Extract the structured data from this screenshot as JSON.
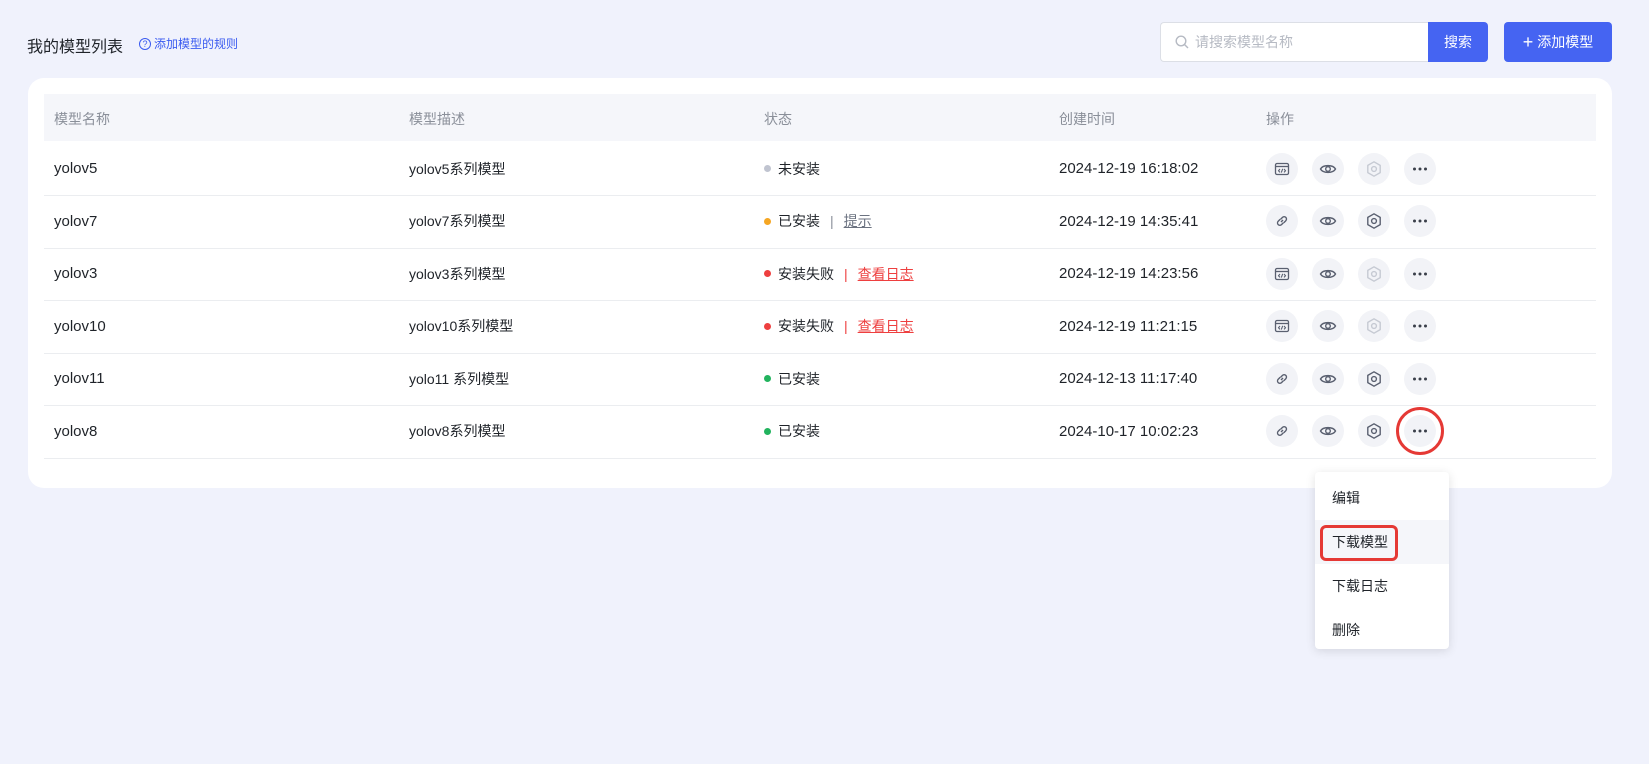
{
  "header": {
    "title": "我的模型列表",
    "rule_link": "添加模型的规则",
    "search_placeholder": "请搜索模型名称",
    "search_button": "搜索",
    "add_button": "添加模型"
  },
  "table": {
    "columns": [
      "模型名称",
      "模型描述",
      "状态",
      "创建时间",
      "操作"
    ],
    "rows": [
      {
        "name": "yolov5",
        "desc": "yolov5系列模型",
        "status": "未安装",
        "status_color": "#c0c4d0",
        "action_text": "",
        "action_style": "",
        "time": "2024-12-19 16:18:02",
        "first_icon": "code-window-icon",
        "settings_enabled": false
      },
      {
        "name": "yolov7",
        "desc": "yolov7系列模型",
        "status": "已安装",
        "status_color": "#f5a623",
        "action_text": "提示",
        "action_style": "gray",
        "time": "2024-12-19 14:35:41",
        "first_icon": "link-icon",
        "settings_enabled": true
      },
      {
        "name": "yolov3",
        "desc": "yolov3系列模型",
        "status": "安装失败",
        "status_color": "#ee3f3f",
        "action_text": "查看日志",
        "action_style": "red",
        "time": "2024-12-19 14:23:56",
        "first_icon": "code-window-icon",
        "settings_enabled": false
      },
      {
        "name": "yolov10",
        "desc": "yolov10系列模型",
        "status": "安装失败",
        "status_color": "#ee3f3f",
        "action_text": "查看日志",
        "action_style": "red",
        "time": "2024-12-19 11:21:15",
        "first_icon": "code-window-icon",
        "settings_enabled": false
      },
      {
        "name": "yolov11",
        "desc": "yolo11 系列模型",
        "status": "已安装",
        "status_color": "#22b35e",
        "action_text": "",
        "action_style": "",
        "time": "2024-12-13 11:17:40",
        "first_icon": "link-icon",
        "settings_enabled": true
      },
      {
        "name": "yolov8",
        "desc": "yolov8系列模型",
        "status": "已安装",
        "status_color": "#22b35e",
        "action_text": "",
        "action_style": "",
        "time": "2024-10-17 10:02:23",
        "first_icon": "link-icon",
        "settings_enabled": true
      }
    ]
  },
  "dropdown_menu": {
    "items": [
      "编辑",
      "下载模型",
      "下载日志",
      "删除"
    ],
    "active_index": 1
  },
  "colors": {
    "accent": "#4564f2",
    "highlight": "#e53935"
  }
}
